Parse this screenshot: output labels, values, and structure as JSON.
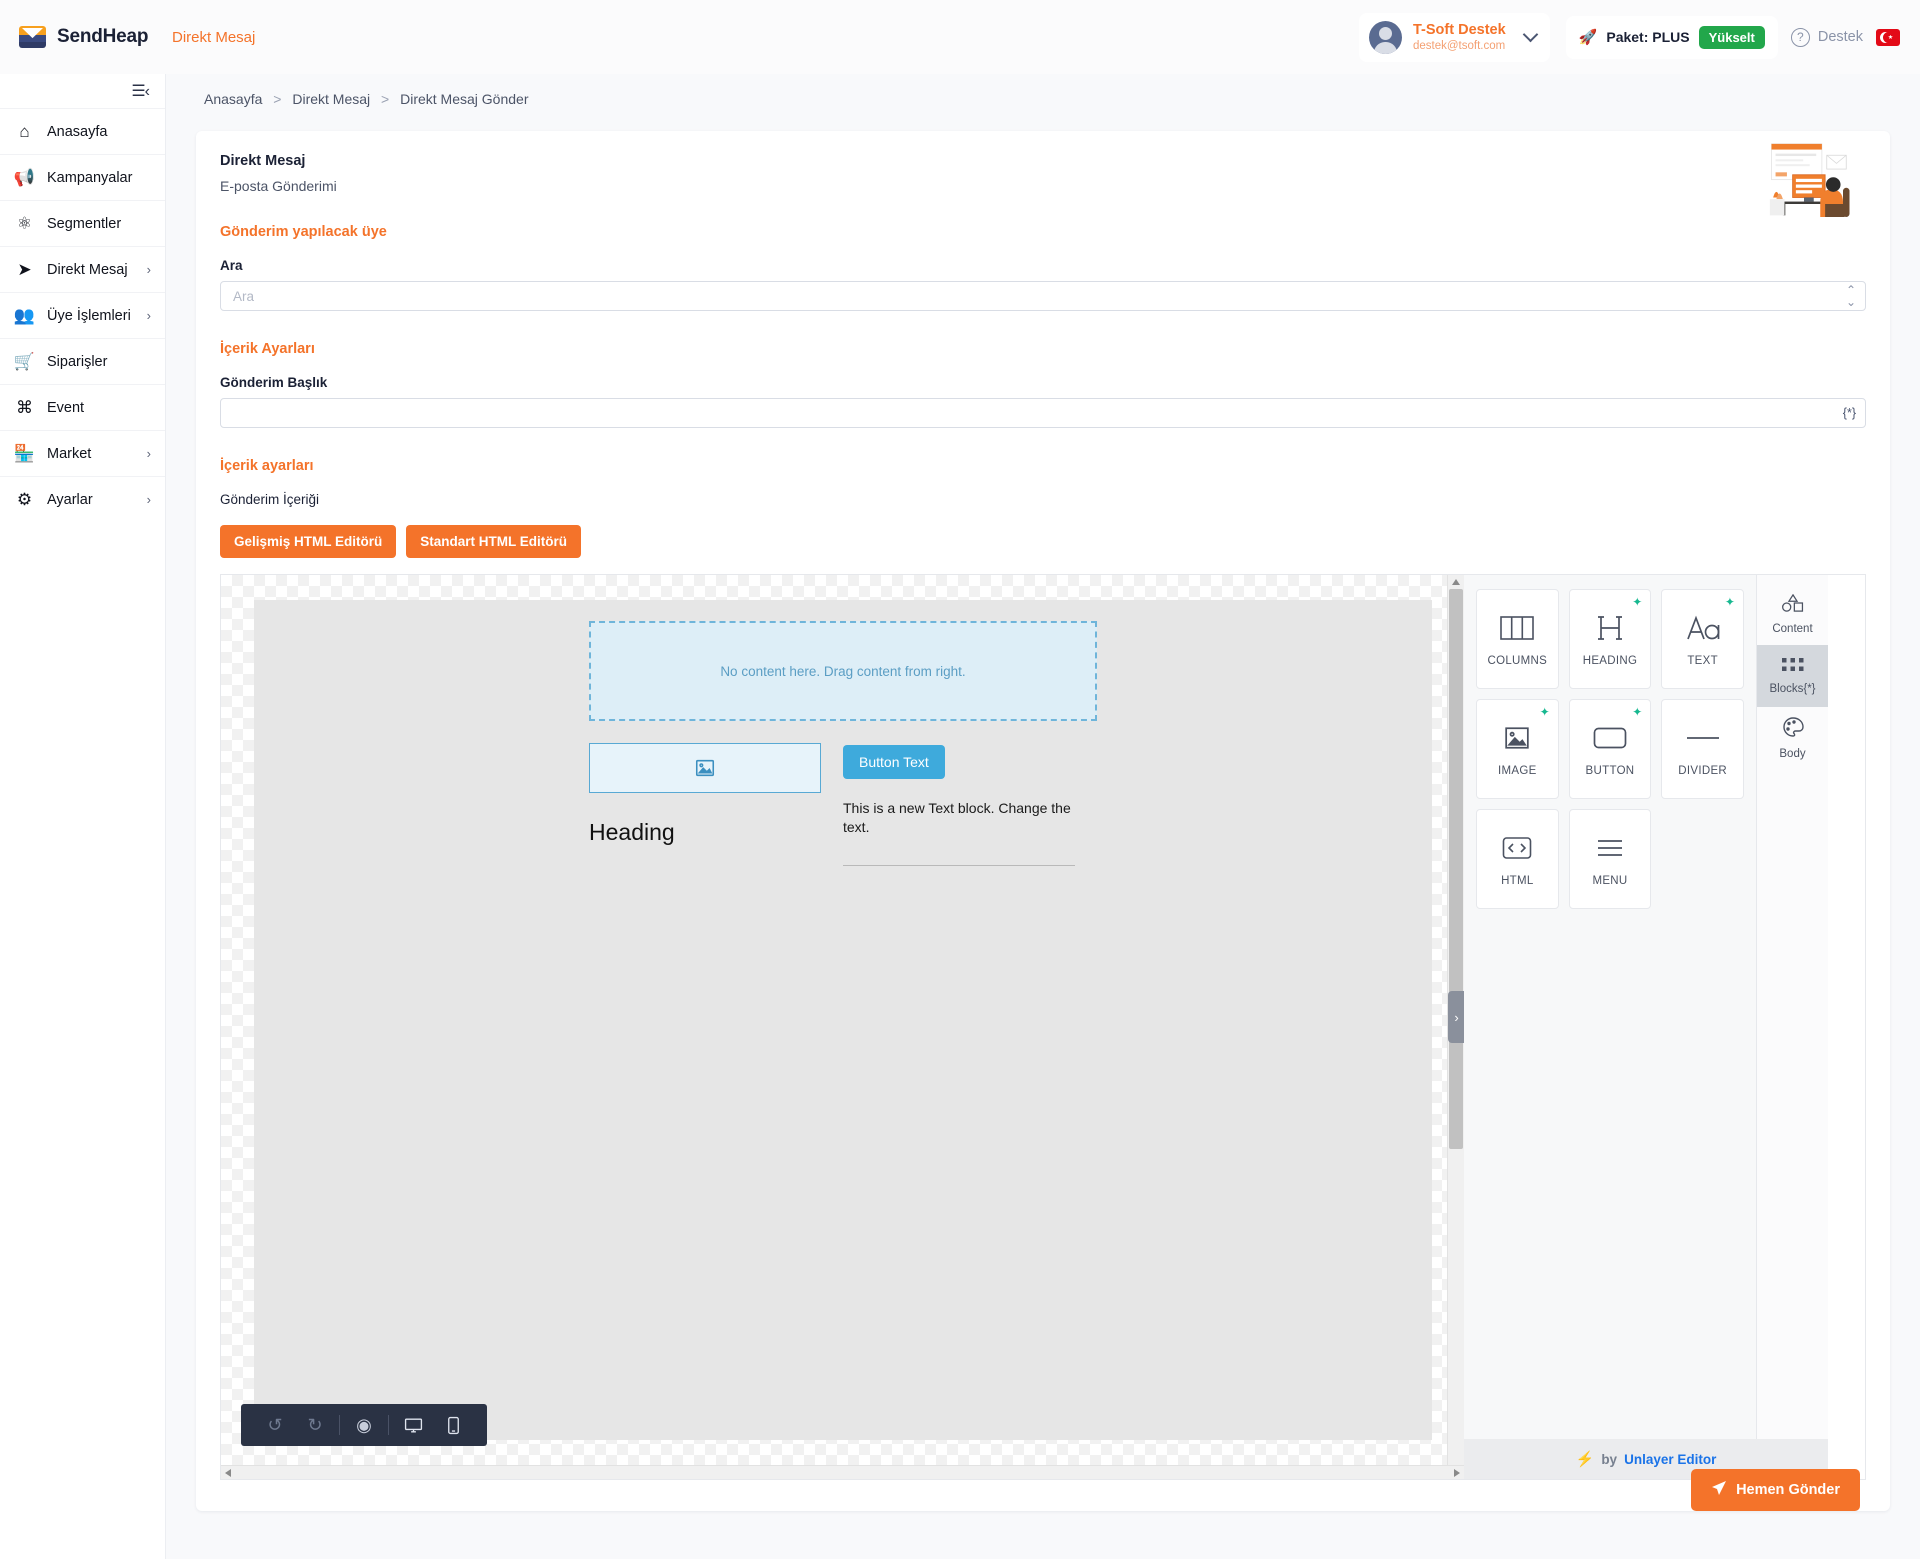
{
  "topbar": {
    "brand": "SendHeap",
    "brand_icon": "envelope-logo-icon",
    "nav_link": "Direkt Mesaj",
    "user": {
      "name": "T-Soft Destek",
      "email": "destek@tsoft.com",
      "chevron_icon": "chevron-down-icon"
    },
    "package": {
      "rocket_icon": "rocket-icon",
      "label": "Paket: PLUS",
      "upgrade": "Yükselt"
    },
    "support": {
      "icon": "question-circle-icon",
      "label": "Destek"
    },
    "language_flag": "turkey-flag-icon"
  },
  "sidebar": {
    "collapse_icon": "collapse-menu-icon",
    "items": [
      {
        "label": "Anasayfa",
        "icon": "home-icon",
        "arrow": ""
      },
      {
        "label": "Kampanyalar",
        "icon": "megaphone-icon",
        "arrow": ""
      },
      {
        "label": "Segmentler",
        "icon": "segments-icon",
        "arrow": ""
      },
      {
        "label": "Direkt Mesaj",
        "icon": "paper-plane-icon",
        "arrow": "›"
      },
      {
        "label": "Üye İşlemleri",
        "icon": "users-icon",
        "arrow": "›"
      },
      {
        "label": "Siparişler",
        "icon": "cart-icon",
        "arrow": ""
      },
      {
        "label": "Event",
        "icon": "command-icon",
        "arrow": ""
      },
      {
        "label": "Market",
        "icon": "store-icon",
        "arrow": "›"
      },
      {
        "label": "Ayarlar",
        "icon": "gear-icon",
        "arrow": "›"
      }
    ]
  },
  "breadcrumb": {
    "items": [
      "Anasayfa",
      "Direkt Mesaj",
      "Direkt Mesaj Gönder"
    ],
    "separator": ">"
  },
  "card": {
    "title": "Direkt Mesaj",
    "subtitle": "E-posta Gönderimi",
    "illustration": "person-at-desk-email-illustration",
    "section_recipient": "Gönderim yapılacak üye",
    "search_label": "Ara",
    "search_value": "",
    "search_placeholder": "Ara",
    "search_adorn_icon": "chevron-updown-icon",
    "section_content_settings": "İçerik Ayarları",
    "subject_label": "Gönderim Başlık",
    "subject_value": "",
    "subject_placeholder": "",
    "subject_adorn": "{*}",
    "section_content_settings_2": "İçerik ayarları",
    "body_label": "Gönderim İçeriği",
    "btn_advanced_editor": "Gelişmiş HTML Editörü",
    "btn_standard_editor": "Standart HTML Editörü"
  },
  "editor": {
    "canvas": {
      "dropzone_text": "No content here. Drag content from right.",
      "image_placeholder_icon": "image-placeholder-icon",
      "heading_text": "Heading",
      "button_text": "Button Text",
      "text_block": "This is a new Text block. Change the text.",
      "divider": "divider-line"
    },
    "toolbar": [
      {
        "name": "undo-icon",
        "glyph": "↶",
        "dim": true
      },
      {
        "name": "redo-icon",
        "glyph": "↷",
        "dim": true
      },
      {
        "name": "preview-eye-icon",
        "glyph": "◉",
        "dim": false
      },
      {
        "name": "desktop-view-icon",
        "glyph": "🖵",
        "dim": false
      },
      {
        "name": "mobile-view-icon",
        "glyph": "▯",
        "dim": false
      }
    ],
    "collapse_handle_icon": "›",
    "tiles": [
      {
        "label": "COLUMNS",
        "icon": "columns-icon",
        "ai": false
      },
      {
        "label": "HEADING",
        "icon": "heading-h-icon",
        "ai": true
      },
      {
        "label": "TEXT",
        "icon": "text-aa-icon",
        "ai": true
      },
      {
        "label": "IMAGE",
        "icon": "image-icon",
        "ai": true
      },
      {
        "label": "BUTTON",
        "icon": "button-icon",
        "ai": true
      },
      {
        "label": "DIVIDER",
        "icon": "divider-icon",
        "ai": false
      },
      {
        "label": "HTML",
        "icon": "code-icon",
        "ai": false
      },
      {
        "label": "MENU",
        "icon": "menu-lines-icon",
        "ai": false
      }
    ],
    "tabs": [
      {
        "label": "Content",
        "icon": "shapes-icon",
        "active": false
      },
      {
        "label": "Blocks{*}",
        "icon": "blocks-grid-icon",
        "active": true
      },
      {
        "label": "Body",
        "icon": "palette-icon",
        "active": false
      }
    ],
    "footer_by": "by",
    "footer_link": "Unlayer Editor",
    "footer_bolt": "bolt-icon"
  },
  "footer": {
    "send_button": "Hemen Gönder",
    "send_icon": "paper-plane-icon"
  },
  "colors": {
    "accent": "#f4732a",
    "green": "#22a74b",
    "blue": "#3eaadc",
    "link": "#1a73e8",
    "ai": "#17b890"
  }
}
